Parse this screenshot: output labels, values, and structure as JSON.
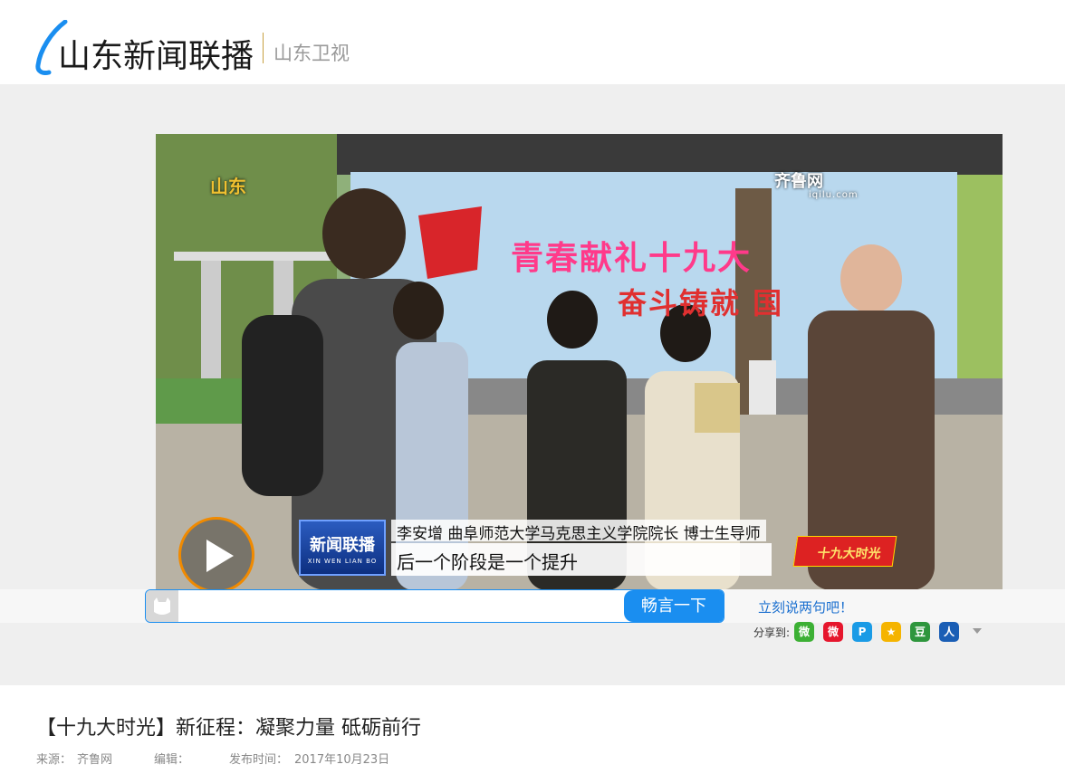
{
  "header": {
    "logo_text": "山东新闻联播",
    "channel": "山东卫视"
  },
  "video": {
    "channel_logo": "山东",
    "watermark": "齐鲁网",
    "watermark_url": "iqilu.com",
    "wall_line1": "青春献礼十九大",
    "wall_line2": "奋斗铸就 国",
    "program_logo": "新闻联播",
    "program_logo_pinyin": "XIN WEN LIAN BO",
    "speaker_caption": "李安增 曲阜师范大学马克思主义学院院长 博士生导师",
    "subtitle": "后一个阶段是一个提升",
    "badge": "十九大时光",
    "play_icon": "play-icon"
  },
  "comment": {
    "placeholder": "",
    "submit_label": "畅言一下",
    "prompt_link": "立刻说两句吧！"
  },
  "share": {
    "label": "分享到:",
    "icons": [
      {
        "name": "wechat-icon",
        "glyph": "微",
        "color": "#3cb034"
      },
      {
        "name": "weibo-icon",
        "glyph": "微",
        "color": "#e6162d"
      },
      {
        "name": "qzone-icon",
        "glyph": "P",
        "color": "#1a9be6"
      },
      {
        "name": "qq-star-icon",
        "glyph": "★",
        "color": "#f5b400"
      },
      {
        "name": "douban-icon",
        "glyph": "豆",
        "color": "#2e963d"
      },
      {
        "name": "renren-icon",
        "glyph": "人",
        "color": "#1a5eb5"
      }
    ]
  },
  "article": {
    "title": "【十九大时光】新征程：凝聚力量 砥砺前行",
    "source_label": "来源：",
    "source": "齐鲁网",
    "editor_label": "编辑：",
    "published_label": "发布时间：",
    "published": "2017年10月23日"
  },
  "colors": {
    "accent": "#1a8ef0",
    "link": "#1a6fcf",
    "play_ring": "#f08a00"
  }
}
